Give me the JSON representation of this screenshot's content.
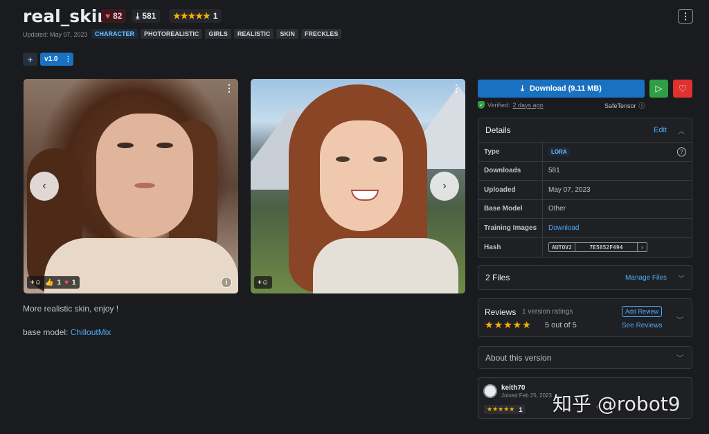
{
  "header": {
    "title": "real_skin",
    "likes": "82",
    "downloads": "581",
    "rating_stars": "★★★★★",
    "rating_count": "1",
    "updated": "Updated: May 07, 2023",
    "tags": [
      "CHARACTER",
      "PHOTOREALISTIC",
      "GIRLS",
      "REALISTIC",
      "SKIN",
      "FRECKLES"
    ]
  },
  "versions": {
    "add": "+",
    "current": "v1.0"
  },
  "gallery": {
    "reactions": {
      "thumbs": "1",
      "hearts": "1"
    }
  },
  "description": {
    "text": "More realistic skin, enjoy !",
    "base_prefix": "base model: ",
    "base_link": "ChilloutMix"
  },
  "download": {
    "label": "Download (9.11 MB)",
    "verified_prefix": "Verified:",
    "verified_when": "2 days ago",
    "format": "SafeTensor"
  },
  "details": {
    "title": "Details",
    "edit": "Edit",
    "rows": [
      {
        "key": "Type",
        "value": "LORA"
      },
      {
        "key": "Downloads",
        "value": "581"
      },
      {
        "key": "Uploaded",
        "value": "May 07, 2023"
      },
      {
        "key": "Base Model",
        "value": "Other"
      },
      {
        "key": "Training Images",
        "value": "Download"
      },
      {
        "key": "Hash",
        "algo": "AUTOV2",
        "value": "7E5852F494"
      }
    ]
  },
  "files": {
    "title": "2 Files",
    "manage": "Manage Files"
  },
  "reviews": {
    "title": "Reviews",
    "count": "1 version ratings",
    "stars": "★★★★★",
    "score": "5 out of 5",
    "add": "Add Review",
    "see": "See Reviews"
  },
  "about": {
    "title": "About this version"
  },
  "creator": {
    "name": "keith70",
    "joined": "Joined Feb 25, 2023",
    "stars": "★★★★★",
    "rating_count": "1"
  },
  "watermark": "知乎 @robot9"
}
